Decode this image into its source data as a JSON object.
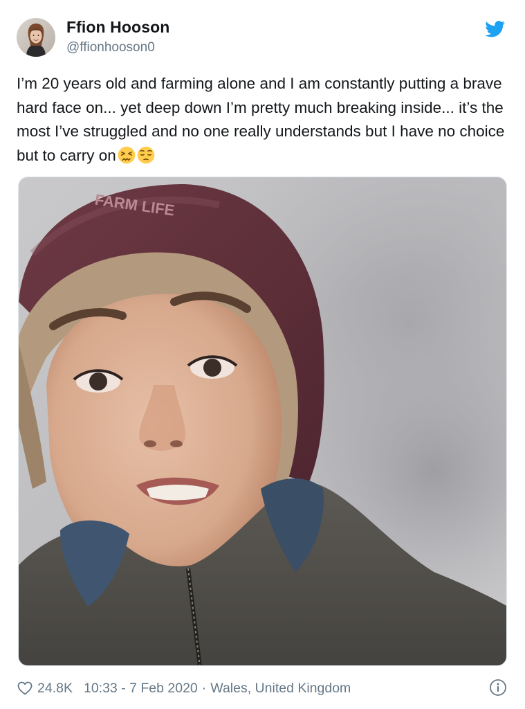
{
  "user": {
    "name": "Ffion Hooson",
    "handle": "@ffionhooson0",
    "avatar": "avatar-photo"
  },
  "tweet": {
    "text": "I’m 20 years old and farming alone and I am constantly putting a brave hard face on... yet deep down I’m pretty much breaking inside... it’s the most I’ve struggled and no one really understands but I have no choice but to carry on",
    "emojis": [
      "persevering-face-emoji",
      "pensive-face-emoji"
    ],
    "photo_beanie_text": "FARM LIFE"
  },
  "footer": {
    "likes": "24.8K",
    "timestamp": "10:33 - 7 Feb 2020",
    "separator": "·",
    "location": "Wales, United Kingdom"
  },
  "icons": {
    "brand": "twitter-bird-icon",
    "like": "heart-icon",
    "info": "info-icon"
  },
  "colors": {
    "twitter_blue": "#1da1f2",
    "text_primary": "#14171a",
    "text_secondary": "#657786",
    "border": "#e1e8ed"
  }
}
